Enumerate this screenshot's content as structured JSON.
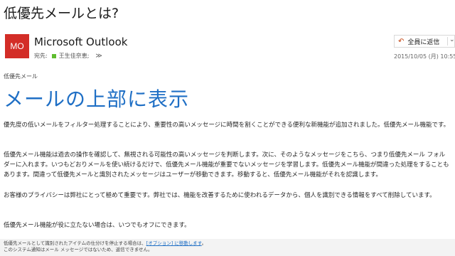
{
  "message": {
    "subject": "低優先メールとは?",
    "sender_initials": "MO",
    "sender_name": "Microsoft Outlook",
    "to_label": "宛先:",
    "to_name": "王生佳奈恵;",
    "expand_symbol": "≫",
    "reply_all_label": "全員に返信",
    "reply_icon": "reply-all-icon",
    "date": "2015/10/05 (月) 10:55"
  },
  "body": {
    "label": "低優先メール",
    "headline": "メールの上部に表示",
    "paragraphs": [
      "優先度の低いメールをフィルター処理することにより、重要性の高いメッセージに時間を割くことができる便利な新機能が追加されました。低優先メール機能です。",
      "低優先メール機能は過去の操作を確認して、無視される可能性の高いメッセージを判断します。次に、そのようなメッセージをこちら、つまり低優先メール フォルダーに入れます。いつもどおりメールを使い続けるだけで、低優先メール機能が重要でないメッセージを学習します。低優先メール機能が間違った処理をすることもあります。間違って低優先メールと識別されたメッセージはユーザーが移動できます。移動すると、低優先メール機能がそれを認識します。",
      "お客様のプライバシーは弊社にとって極めて重要です。弊社では、機能を改善するために使われるデータから、個人を識別できる情報をすべて削除しています。",
      "低優先メール機能が役に立たない場合は、いつでもオフにできます。"
    ]
  },
  "footer": {
    "line1_prefix": "低優先メールとして識別されたアイテムの仕分けを停止する場合は、",
    "line1_link": "[オプション] に移動します",
    "line1_suffix": "。",
    "line2": "このシステム通知はメール メッセージではないため、返信できません。"
  },
  "colors": {
    "avatar_bg": "#d32d27",
    "headline": "#1f6fc5",
    "presence": "#5fbd2f"
  }
}
